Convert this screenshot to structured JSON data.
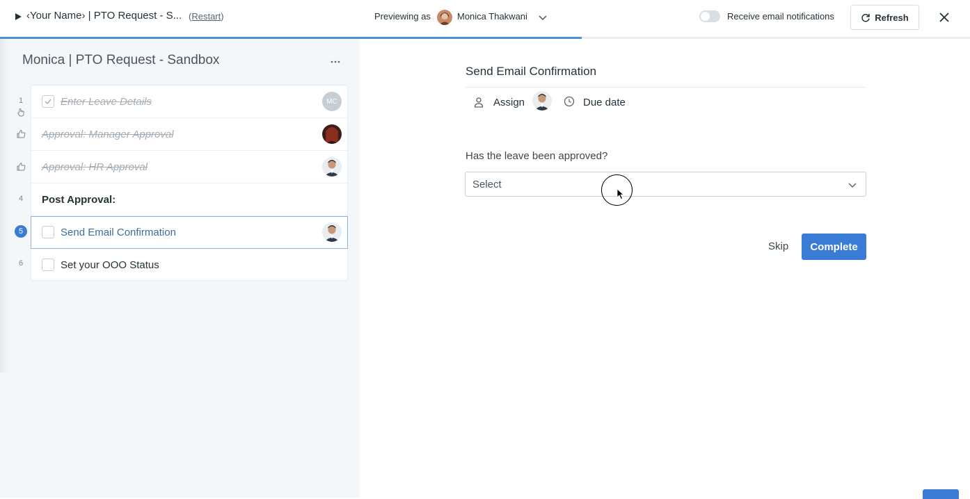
{
  "header": {
    "title": "‹Your Name› | PTO Request - S...",
    "restart_open": "(",
    "restart_link": "Restart",
    "restart_close": ")",
    "previewing_label": "Previewing as",
    "preview_user": "Monica Thakwani",
    "notifications_label": "Receive email notifications",
    "notifications_on": false,
    "refresh_label": "Refresh",
    "progress_fraction": 0.6
  },
  "sidebar": {
    "workflow_title": "Monica | PTO Request - Sandbox",
    "tasks": [
      {
        "number": "1",
        "label": "Enter Leave Details",
        "state": "done",
        "assignee_initials": "MC"
      },
      {
        "number": "",
        "label": "Approval: Manager Approval",
        "state": "done",
        "type": "approval"
      },
      {
        "number": "",
        "label": "Approval: HR Approval",
        "state": "done",
        "type": "approval"
      },
      {
        "number": "4",
        "label": "Post Approval:",
        "state": "heading"
      },
      {
        "number": "5",
        "label": "Send Email Confirmation",
        "state": "current"
      },
      {
        "number": "6",
        "label": "Set your OOO Status",
        "state": "todo"
      }
    ]
  },
  "task": {
    "title": "Send Email Confirmation",
    "assign_label": "Assign",
    "due_label": "Due date",
    "question": "Has the leave been approved?",
    "select_value": "Select",
    "skip_label": "Skip",
    "complete_label": "Complete"
  },
  "colors": {
    "accent": "#3a7bd5",
    "progress": "#4a8fd8"
  }
}
